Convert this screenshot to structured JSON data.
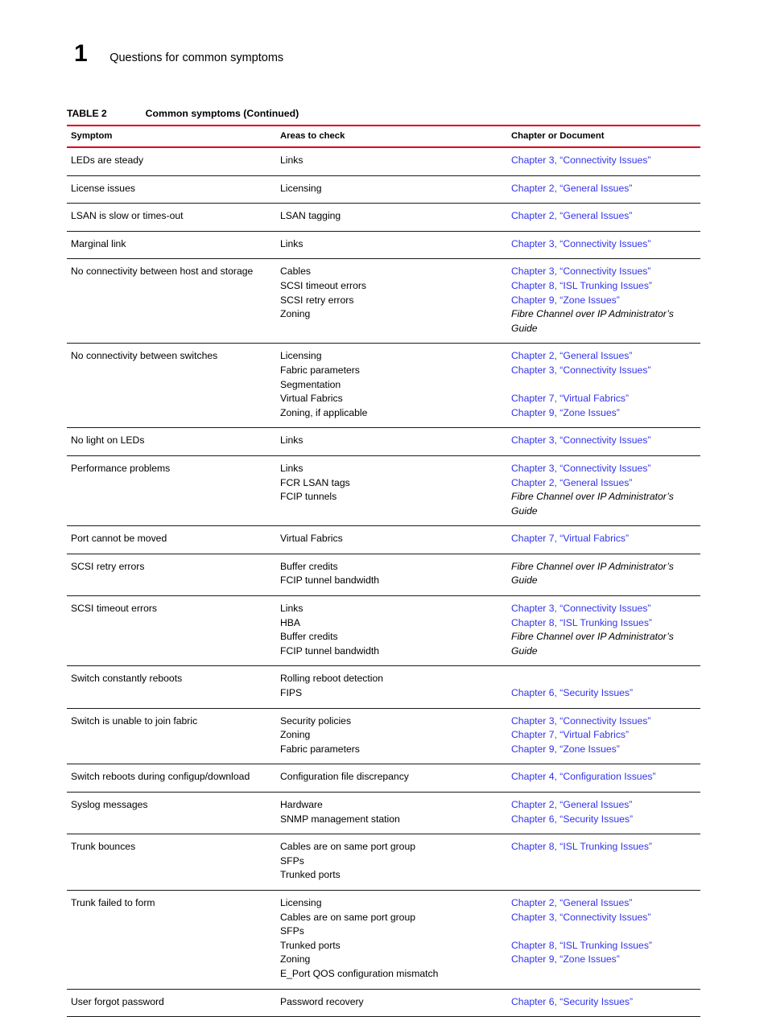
{
  "page": {
    "chapter_number": "1",
    "chapter_title": "Questions for common symptoms"
  },
  "table": {
    "caption_label": "TABLE 2",
    "caption_text": "Common symptoms  (Continued)",
    "rule_color": "#e1001a",
    "link_color": "#3333ee",
    "headers": [
      "Symptom",
      "Areas to check",
      "Chapter or Document"
    ],
    "rows": [
      {
        "symptom": [
          "LEDs are steady"
        ],
        "areas": [
          "Links"
        ],
        "refs": [
          {
            "text": "Chapter 3, “Connectivity Issues”",
            "style": "link"
          }
        ]
      },
      {
        "symptom": [
          "License issues"
        ],
        "areas": [
          "Licensing"
        ],
        "refs": [
          {
            "text": "Chapter 2, “General Issues”",
            "style": "link"
          }
        ]
      },
      {
        "symptom": [
          "LSAN is slow or times-out"
        ],
        "areas": [
          "LSAN tagging"
        ],
        "refs": [
          {
            "text": "Chapter 2, “General Issues”",
            "style": "link"
          }
        ]
      },
      {
        "symptom": [
          "Marginal link"
        ],
        "areas": [
          "Links"
        ],
        "refs": [
          {
            "text": "Chapter 3, “Connectivity Issues”",
            "style": "link"
          }
        ]
      },
      {
        "symptom": [
          "No connectivity between host and storage"
        ],
        "areas": [
          "Cables",
          "SCSI timeout errors",
          "SCSI retry errors",
          "Zoning"
        ],
        "refs": [
          {
            "text": "Chapter 3, “Connectivity Issues”",
            "style": "link"
          },
          {
            "text": "Chapter 8, “ISL Trunking Issues”",
            "style": "link"
          },
          {
            "text": "Chapter 9, “Zone Issues”",
            "style": "link"
          },
          {
            "text": "Fibre Channel over IP Administrator’s Guide",
            "style": "doc"
          }
        ]
      },
      {
        "symptom": [
          "No connectivity between switches"
        ],
        "areas": [
          "Licensing",
          "Fabric parameters",
          "Segmentation",
          "Virtual Fabrics",
          "Zoning, if applicable"
        ],
        "refs": [
          {
            "text": "Chapter 2, “General Issues”",
            "style": "link"
          },
          {
            "text": "Chapter 3, “Connectivity Issues”",
            "style": "link"
          },
          {
            "text": "",
            "style": "blank"
          },
          {
            "text": "Chapter 7, “Virtual Fabrics”",
            "style": "link"
          },
          {
            "text": "Chapter 9, “Zone Issues”",
            "style": "link"
          }
        ]
      },
      {
        "symptom": [
          "No light on LEDs"
        ],
        "areas": [
          "Links"
        ],
        "refs": [
          {
            "text": "Chapter 3, “Connectivity Issues”",
            "style": "link"
          }
        ]
      },
      {
        "symptom": [
          "Performance problems"
        ],
        "areas": [
          "Links",
          "FCR LSAN tags",
          "FCIP tunnels"
        ],
        "refs": [
          {
            "text": "Chapter 3, “Connectivity Issues”",
            "style": "link"
          },
          {
            "text": "Chapter 2, “General Issues”",
            "style": "link"
          },
          {
            "text": "Fibre Channel over IP Administrator’s Guide",
            "style": "doc"
          }
        ]
      },
      {
        "symptom": [
          "Port cannot be moved"
        ],
        "areas": [
          "Virtual Fabrics"
        ],
        "refs": [
          {
            "text": "Chapter 7, “Virtual Fabrics”",
            "style": "link"
          }
        ]
      },
      {
        "symptom": [
          "SCSI retry errors"
        ],
        "areas": [
          "Buffer credits",
          "FCIP tunnel bandwidth"
        ],
        "refs": [
          {
            "text": "Fibre Channel over IP Administrator’s Guide",
            "style": "doc"
          }
        ]
      },
      {
        "symptom": [
          "SCSI timeout errors"
        ],
        "areas": [
          "Links",
          "HBA",
          "Buffer credits",
          "FCIP tunnel bandwidth"
        ],
        "refs": [
          {
            "text": "Chapter 3, “Connectivity Issues”",
            "style": "link"
          },
          {
            "text": "Chapter 8, “ISL Trunking Issues”",
            "style": "link"
          },
          {
            "text": "Fibre Channel over IP Administrator’s Guide",
            "style": "doc"
          }
        ]
      },
      {
        "symptom": [
          "Switch constantly reboots"
        ],
        "areas": [
          "Rolling reboot detection",
          "FIPS"
        ],
        "refs": [
          {
            "text": "",
            "style": "blank"
          },
          {
            "text": "Chapter 6, “Security Issues”",
            "style": "link"
          }
        ]
      },
      {
        "symptom": [
          "Switch is unable to join fabric"
        ],
        "areas": [
          "Security policies",
          "Zoning",
          "Fabric parameters"
        ],
        "refs": [
          {
            "text": "Chapter 3, “Connectivity Issues”",
            "style": "link"
          },
          {
            "text": "Chapter 7, “Virtual Fabrics”",
            "style": "link"
          },
          {
            "text": "Chapter 9, “Zone Issues”",
            "style": "link"
          }
        ]
      },
      {
        "symptom": [
          "Switch reboots during configup/download"
        ],
        "areas": [
          "Configuration file discrepancy"
        ],
        "refs": [
          {
            "text": "Chapter 4, “Configuration Issues”",
            "style": "link"
          }
        ]
      },
      {
        "symptom": [
          "Syslog messages"
        ],
        "areas": [
          "Hardware",
          "SNMP management station"
        ],
        "refs": [
          {
            "text": "Chapter 2, “General Issues”",
            "style": "link"
          },
          {
            "text": "Chapter 6, “Security Issues”",
            "style": "link"
          }
        ]
      },
      {
        "symptom": [
          "Trunk bounces"
        ],
        "areas": [
          "Cables are on same port group",
          "SFPs",
          "Trunked ports"
        ],
        "refs": [
          {
            "text": "Chapter 8, “ISL Trunking Issues”",
            "style": "link"
          }
        ]
      },
      {
        "symptom": [
          "Trunk failed to form"
        ],
        "areas": [
          "Licensing",
          "Cables are on same port group",
          "SFPs",
          "Trunked ports",
          "Zoning",
          "E_Port QOS configuration mismatch"
        ],
        "refs": [
          {
            "text": "Chapter 2, “General Issues”",
            "style": "link"
          },
          {
            "text": "Chapter 3, “Connectivity Issues”",
            "style": "link"
          },
          {
            "text": "",
            "style": "blank"
          },
          {
            "text": "Chapter 8, “ISL Trunking Issues”",
            "style": "link"
          },
          {
            "text": "Chapter 9, “Zone Issues”",
            "style": "link"
          }
        ]
      },
      {
        "symptom": [
          "User forgot password"
        ],
        "areas": [
          "Password recovery"
        ],
        "refs": [
          {
            "text": "Chapter 6, “Security Issues”",
            "style": "link"
          }
        ]
      }
    ]
  }
}
